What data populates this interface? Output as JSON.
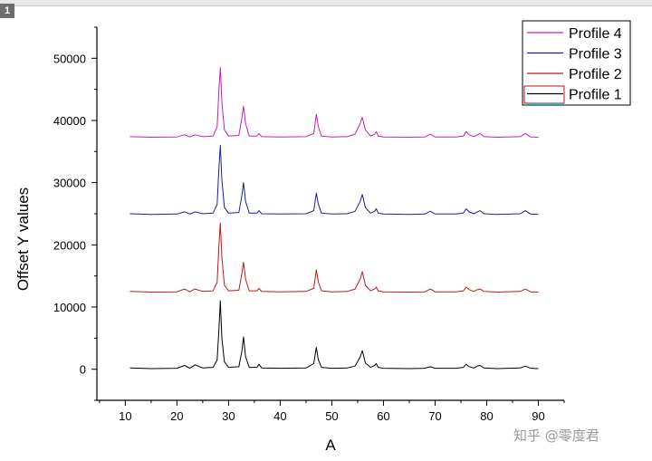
{
  "window": {
    "layer_label": "1"
  },
  "watermark": "知乎 @零度君",
  "chart_data": {
    "type": "line",
    "xlabel": "A",
    "ylabel": "Offset Y values",
    "xlim": [
      4.5,
      95
    ],
    "ylim": [
      -5000,
      55000
    ],
    "xticks": [
      10,
      20,
      30,
      40,
      50,
      60,
      70,
      80,
      90
    ],
    "yticks": [
      0,
      10000,
      20000,
      30000,
      40000,
      50000
    ],
    "grid": false,
    "legend_position": "top-right",
    "legend_entries": [
      "Profile 4",
      "Profile 3",
      "Profile 2",
      "Profile 1"
    ],
    "series": [
      {
        "name": "Profile 1",
        "color": "#000000",
        "x": [
          10.9,
          15,
          20,
          21.5,
          22.5,
          23.5,
          25,
          27,
          27.8,
          28.1,
          28.4,
          28.7,
          29.2,
          30,
          32,
          32.6,
          32.9,
          33.3,
          34,
          35.5,
          35.9,
          36.4,
          40,
          45,
          46.5,
          47,
          47.4,
          48,
          50,
          53,
          54.5,
          55.5,
          55.9,
          56.5,
          57.5,
          58.3,
          58.6,
          59,
          60,
          65,
          68,
          69.1,
          70,
          74,
          75.5,
          76,
          76.6,
          77.5,
          78.2,
          78.7,
          79.5,
          82,
          86.5,
          87.5,
          88.5,
          90
        ],
        "y": [
          200,
          100,
          150,
          600,
          150,
          700,
          200,
          300,
          1500,
          6000,
          11000,
          5000,
          1200,
          300,
          400,
          3000,
          5200,
          2000,
          300,
          300,
          800,
          200,
          150,
          200,
          900,
          3500,
          1500,
          300,
          150,
          200,
          500,
          2000,
          3000,
          1000,
          300,
          600,
          900,
          300,
          150,
          100,
          150,
          400,
          150,
          150,
          300,
          800,
          400,
          200,
          500,
          600,
          200,
          100,
          200,
          500,
          150,
          100
        ]
      },
      {
        "name": "Profile 2",
        "color": "#c0191b",
        "x": [
          10.9,
          15,
          20,
          21.5,
          22.5,
          23.5,
          25,
          27,
          27.8,
          28.1,
          28.4,
          28.7,
          29.2,
          30,
          32,
          32.6,
          32.9,
          33.3,
          34,
          35.5,
          35.9,
          36.4,
          40,
          45,
          46.5,
          47,
          47.4,
          48,
          50,
          53,
          54.5,
          55.5,
          55.9,
          56.5,
          57.5,
          58.3,
          58.6,
          59,
          60,
          65,
          68,
          69.1,
          70,
          74,
          75.5,
          76,
          76.6,
          77.5,
          78.2,
          78.7,
          79.5,
          82,
          86.5,
          87.5,
          88.5,
          90
        ],
        "y": [
          12500,
          12400,
          12450,
          12900,
          12450,
          12900,
          12500,
          12600,
          14000,
          19500,
          23500,
          18000,
          13500,
          12600,
          12700,
          15500,
          17200,
          14500,
          12600,
          12600,
          13000,
          12500,
          12450,
          12500,
          13000,
          16000,
          14000,
          12600,
          12450,
          12500,
          12900,
          14500,
          15700,
          13500,
          12600,
          12900,
          13200,
          12600,
          12450,
          12400,
          12450,
          12900,
          12450,
          12450,
          12600,
          13200,
          12800,
          12500,
          12800,
          12900,
          12500,
          12400,
          12500,
          12900,
          12450,
          12400
        ]
      },
      {
        "name": "Profile 3",
        "color": "#1f1f8f",
        "x": [
          10.9,
          15,
          20,
          21.5,
          22.5,
          23.5,
          25,
          27,
          27.8,
          28.1,
          28.4,
          28.7,
          29.2,
          30,
          32,
          32.6,
          32.9,
          33.3,
          34,
          35.5,
          35.9,
          36.4,
          40,
          45,
          46.5,
          47,
          47.4,
          48,
          50,
          53,
          54.5,
          55.5,
          55.9,
          56.5,
          57.5,
          58.3,
          58.6,
          59,
          60,
          65,
          68,
          69.1,
          70,
          74,
          75.5,
          76,
          76.6,
          77.5,
          78.2,
          78.7,
          79.5,
          82,
          86.5,
          87.5,
          88.5,
          90
        ],
        "y": [
          25000,
          24900,
          24950,
          25300,
          24950,
          25300,
          25000,
          25100,
          26500,
          32000,
          36000,
          30500,
          26000,
          25100,
          25200,
          28000,
          30000,
          27000,
          25100,
          25100,
          25500,
          25000,
          24950,
          25000,
          25500,
          28300,
          26500,
          25100,
          24950,
          25000,
          25400,
          27000,
          28100,
          26000,
          25100,
          25400,
          25800,
          25100,
          24950,
          24900,
          24950,
          25400,
          24950,
          24950,
          25100,
          25800,
          25300,
          25000,
          25300,
          25500,
          25000,
          24900,
          25000,
          25500,
          24950,
          24900
        ]
      },
      {
        "name": "Profile 4",
        "color": "#c020c0",
        "x": [
          10.9,
          15,
          20,
          21.5,
          22.5,
          23.5,
          25,
          27,
          27.8,
          28.1,
          28.4,
          28.7,
          29.2,
          30,
          32,
          32.6,
          32.9,
          33.3,
          34,
          35.5,
          35.9,
          36.4,
          40,
          45,
          46.5,
          47,
          47.4,
          48,
          50,
          53,
          54.5,
          55.5,
          55.9,
          56.5,
          57.5,
          58.3,
          58.6,
          59,
          60,
          65,
          68,
          69.1,
          70,
          74,
          75.5,
          76,
          76.6,
          77.5,
          78.2,
          78.7,
          79.5,
          82,
          86.5,
          87.5,
          88.5,
          90
        ],
        "y": [
          37400,
          37300,
          37350,
          37700,
          37350,
          37700,
          37400,
          37500,
          39000,
          44500,
          48500,
          43000,
          38500,
          37500,
          37600,
          40500,
          42300,
          39500,
          37500,
          37500,
          37900,
          37400,
          37350,
          37400,
          37900,
          41000,
          39000,
          37500,
          37350,
          37400,
          37800,
          39500,
          40500,
          38500,
          37500,
          37800,
          38200,
          37500,
          37350,
          37300,
          37350,
          37800,
          37350,
          37350,
          37500,
          38200,
          37700,
          37400,
          37700,
          37900,
          37400,
          37300,
          37400,
          37900,
          37350,
          37300
        ]
      }
    ]
  }
}
